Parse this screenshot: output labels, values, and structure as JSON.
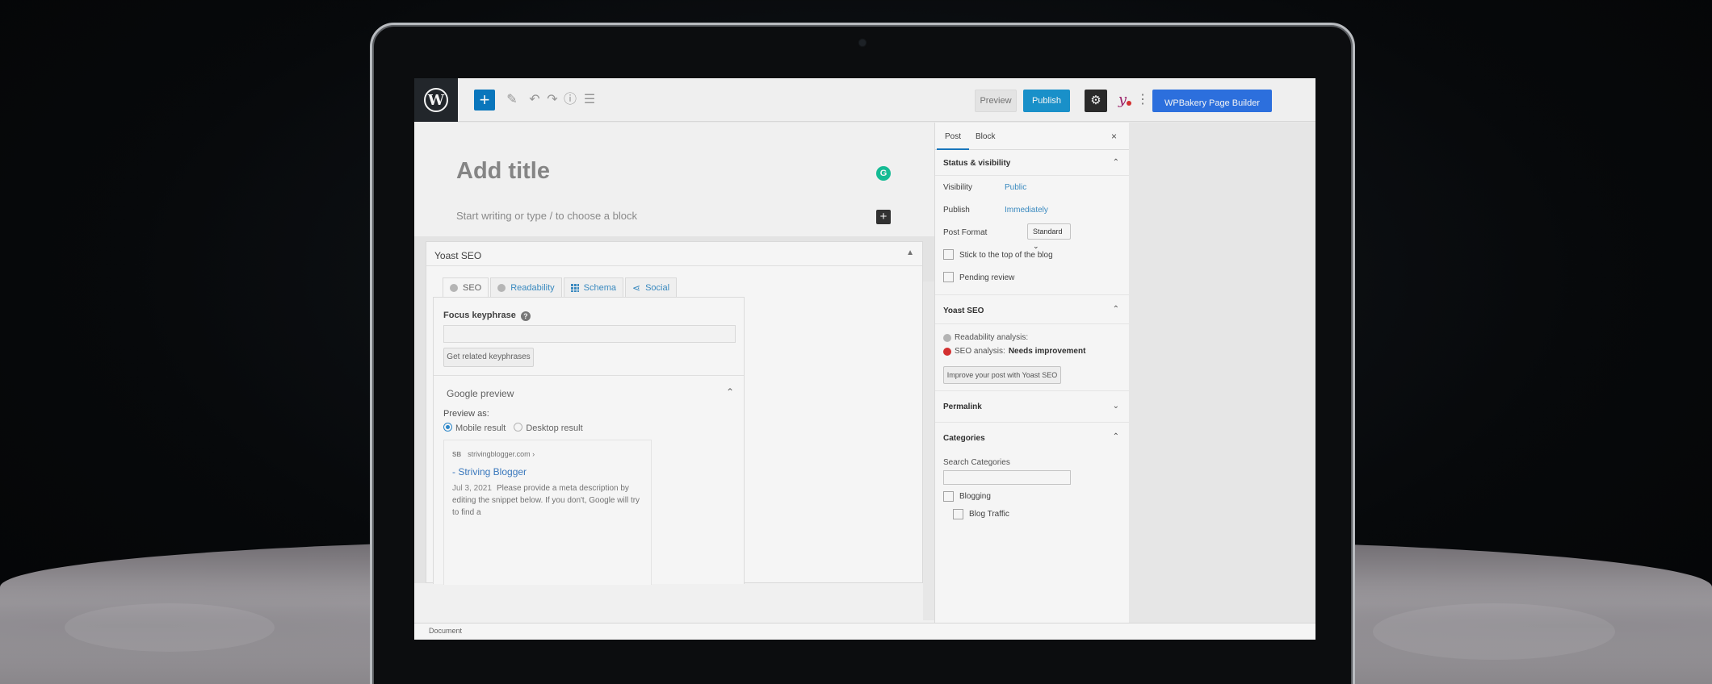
{
  "toolbar": {
    "preview_label": "Preview",
    "publish_label": "Publish",
    "yoast_label": "y",
    "more_label": "⋮",
    "wpbakery_label": "WPBakery Page Builder"
  },
  "editor": {
    "title_placeholder": "Add title",
    "block_placeholder": "Start writing or type / to choose a block"
  },
  "yoast_box": {
    "title": "Yoast SEO",
    "tabs": [
      {
        "label": "SEO"
      },
      {
        "label": "Readability"
      },
      {
        "label": "Schema"
      },
      {
        "label": "Social"
      }
    ],
    "focus_keyphrase_label": "Focus keyphrase",
    "related_button": "Get related keyphrases",
    "google_preview_title": "Google preview",
    "preview_as_label": "Preview as:",
    "mobile_label": "Mobile result",
    "desktop_label": "Desktop result",
    "serp": {
      "favicon": "SB",
      "url": "strivingblogger.com ›",
      "title": "- Striving Blogger",
      "date": "Jul 3, 2021",
      "description": "Please provide a meta description by editing the snippet below. If you don't, Google will try to find a"
    }
  },
  "statusbar": {
    "label": "Document"
  },
  "sidebar": {
    "tab_post": "Post",
    "tab_block": "Block",
    "close": "×",
    "status": {
      "title": "Status & visibility",
      "visibility_label": "Visibility",
      "visibility_value": "Public",
      "publish_label": "Publish",
      "publish_value": "Immediately",
      "format_label": "Post Format",
      "format_value": "Standard",
      "stick_label": "Stick to the top of the blog",
      "pending_label": "Pending review"
    },
    "yoast": {
      "title": "Yoast SEO",
      "readability": "Readability analysis:",
      "seo_prefix": "SEO analysis:",
      "seo_value": "Needs improvement",
      "improve_button": "Improve your post with Yoast SEO"
    },
    "permalink": {
      "title": "Permalink"
    },
    "categories": {
      "title": "Categories",
      "search_label": "Search Categories",
      "items": [
        {
          "label": "Blogging"
        },
        {
          "label": "Blog Traffic"
        }
      ]
    }
  },
  "colors": {
    "wp_blue": "#1a96d1",
    "wpbakery_blue": "#2e74e6",
    "link_blue": "#3b8fc7",
    "grammarly_green": "#15c39a",
    "error_red": "#dc3232"
  }
}
